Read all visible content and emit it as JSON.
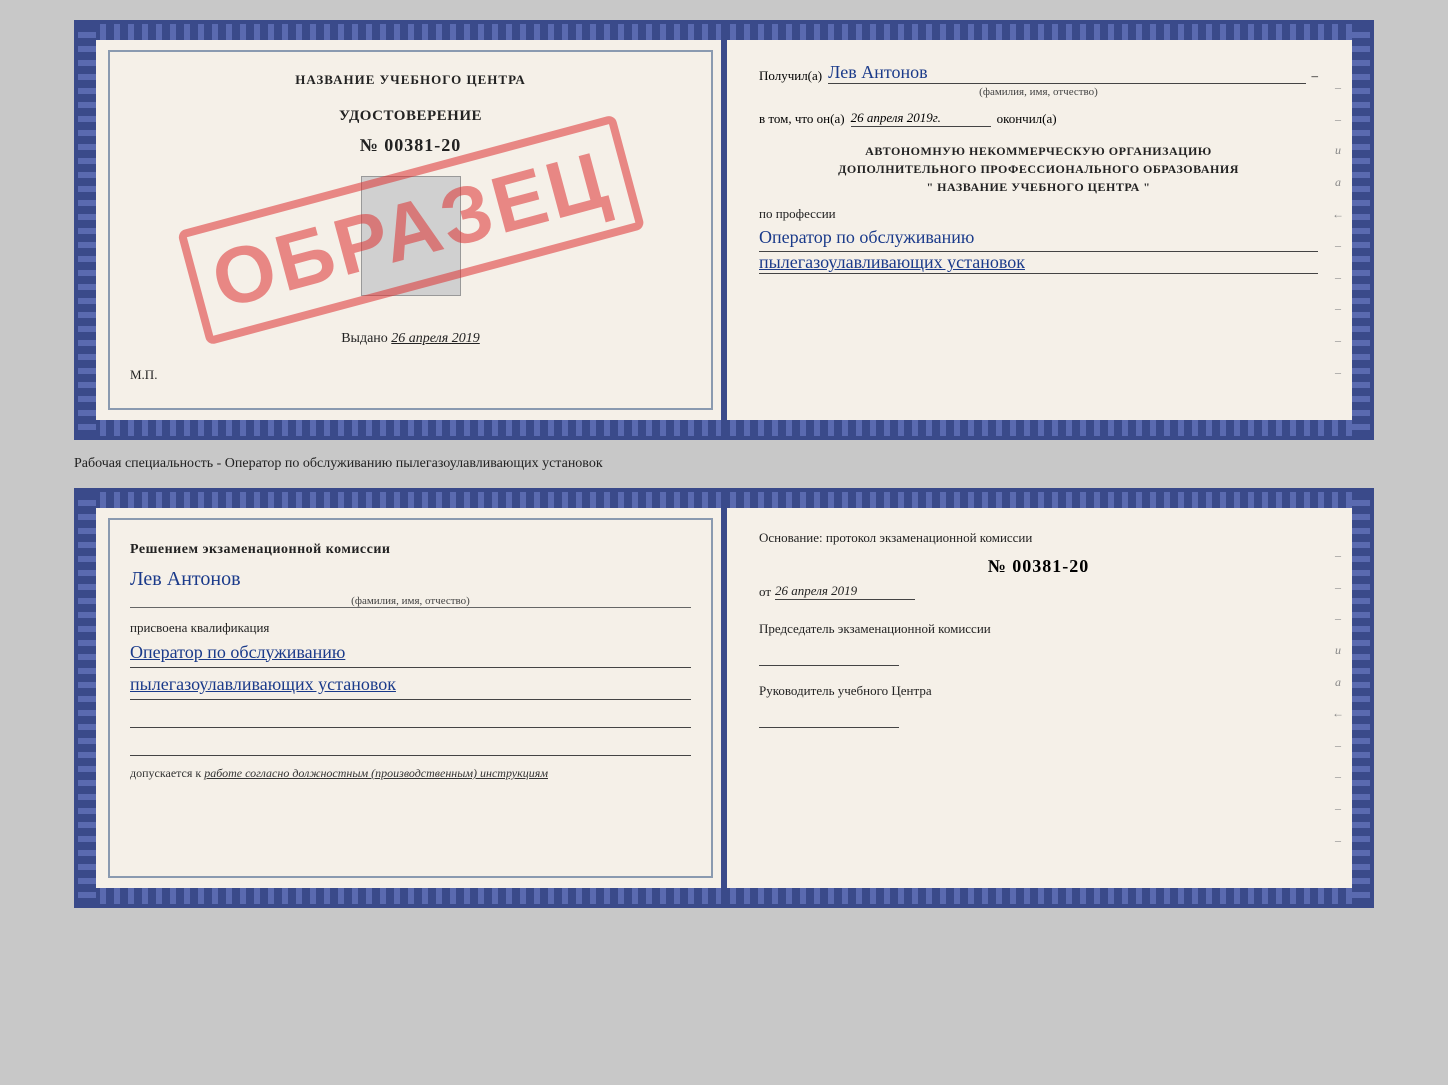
{
  "certificate": {
    "left": {
      "header": "НАЗВАНИЕ УЧЕБНОГО ЦЕНТРА",
      "udostoverenie_label": "УДОСТОВЕРЕНИЕ",
      "number": "№ 00381-20",
      "vydano_label": "Выдано",
      "vydano_date": "26 апреля 2019",
      "mp": "М.П.",
      "stamp_text": "ОБРАЗЕЦ"
    },
    "right": {
      "poluchil_label": "Получил(а)",
      "poluchil_value": "Лев Антонов",
      "fio_sublabel": "(фамилия, имя, отчество)",
      "dash": "–",
      "vtom_label": "в том, что он(а)",
      "vtom_date": "26 апреля 2019г.",
      "okончил_label": "окончил(а)",
      "org_line1": "АВТОНОМНУЮ НЕКОММЕРЧЕСКУЮ ОРГАНИЗАЦИЮ",
      "org_line2": "ДОПОЛНИТЕЛЬНОГО ПРОФЕССИОНАЛЬНОГО ОБРАЗОВАНИЯ",
      "org_line3": "\"  НАЗВАНИЕ УЧЕБНОГО ЦЕНТРА  \"",
      "po_professii_label": "по профессии",
      "profession_line1": "Оператор по обслуживанию",
      "profession_line2": "пылегазоулавливающих установок"
    }
  },
  "middle": {
    "text": "Рабочая специальность - Оператор по обслуживанию пылегазоулавливающих установок"
  },
  "diploma": {
    "left": {
      "resheniem_label": "Решением экзаменационной комиссии",
      "fio_value": "Лев Антонов",
      "fio_sublabel": "(фамилия, имя, отчество)",
      "prisvoena_label": "присвоена квалификация",
      "profession_line1": "Оператор по обслуживанию",
      "profession_line2": "пылегазоулавливающих установок",
      "dopuskaetsya_label": "допускается к",
      "dopuskaetsya_value": "работе согласно должностным (производственным) инструкциям"
    },
    "right": {
      "osnovanie_label": "Основание: протокол экзаменационной комиссии",
      "number": "№  00381-20",
      "ot_label": "от",
      "ot_date": "26 апреля 2019",
      "predsedatel_label": "Председатель экзаменационной комиссии",
      "rukovoditel_label": "Руководитель учебного Центра"
    }
  }
}
